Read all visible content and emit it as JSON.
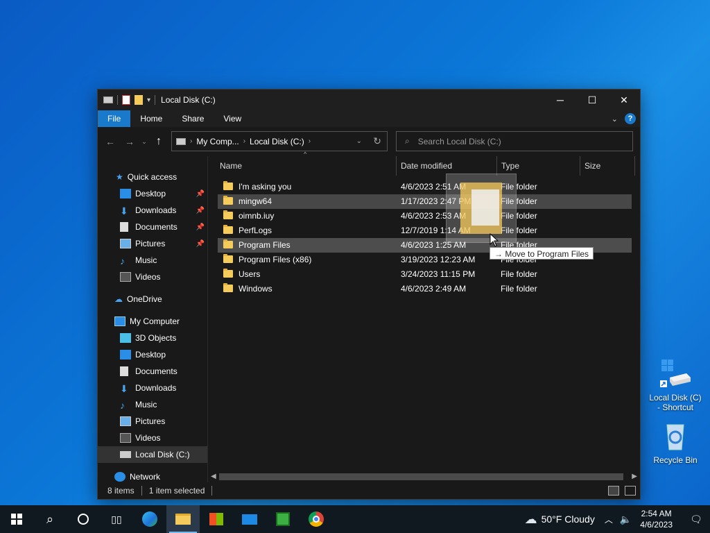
{
  "window": {
    "title": "Local Disk (C:)",
    "ribbon_tabs": [
      "File",
      "Home",
      "Share",
      "View"
    ],
    "address": {
      "crumbs": [
        "My Comp...",
        "Local Disk (C:)"
      ]
    },
    "search_placeholder": "Search Local Disk (C:)"
  },
  "nav": {
    "quick_access": "Quick access",
    "quick_items": [
      {
        "label": "Desktop",
        "pinned": true
      },
      {
        "label": "Downloads",
        "pinned": true
      },
      {
        "label": "Documents",
        "pinned": true
      },
      {
        "label": "Pictures",
        "pinned": true
      },
      {
        "label": "Music",
        "pinned": false
      },
      {
        "label": "Videos",
        "pinned": false
      }
    ],
    "onedrive": "OneDrive",
    "my_computer": "My Computer",
    "computer_items": [
      "3D Objects",
      "Desktop",
      "Documents",
      "Downloads",
      "Music",
      "Pictures",
      "Videos",
      "Local Disk (C:)"
    ],
    "network": "Network"
  },
  "columns": [
    "Name",
    "Date modified",
    "Type",
    "Size"
  ],
  "files": [
    {
      "name": "I'm  asking you",
      "date": "4/6/2023 2:51 AM",
      "type": "File folder"
    },
    {
      "name": "mingw64",
      "date": "1/17/2023 2:47 PM",
      "type": "File folder"
    },
    {
      "name": "oimnb.iuy",
      "date": "4/6/2023 2:53 AM",
      "type": "File folder"
    },
    {
      "name": "PerfLogs",
      "date": "12/7/2019 1:14 AM",
      "type": "File folder"
    },
    {
      "name": "Program Files",
      "date": "4/6/2023 1:25 AM",
      "type": "File folder"
    },
    {
      "name": "Program Files (x86)",
      "date": "3/19/2023 12:23 AM",
      "type": "File folder"
    },
    {
      "name": "Users",
      "date": "3/24/2023 11:15 PM",
      "type": "File folder"
    },
    {
      "name": "Windows",
      "date": "4/6/2023 2:49 AM",
      "type": "File folder"
    }
  ],
  "drag_tooltip": "Move to Program Files",
  "status": {
    "items": "8 items",
    "selected": "1 item selected"
  },
  "desktop": {
    "icons": [
      {
        "label": "Local Disk (C) - Shortcut"
      },
      {
        "label": "Recycle Bin"
      }
    ]
  },
  "taskbar": {
    "weather": "50°F  Cloudy",
    "time": "2:54 AM",
    "date": "4/6/2023"
  },
  "colors": {
    "accent": "#1979ca",
    "folder": "#f5cb5c"
  }
}
